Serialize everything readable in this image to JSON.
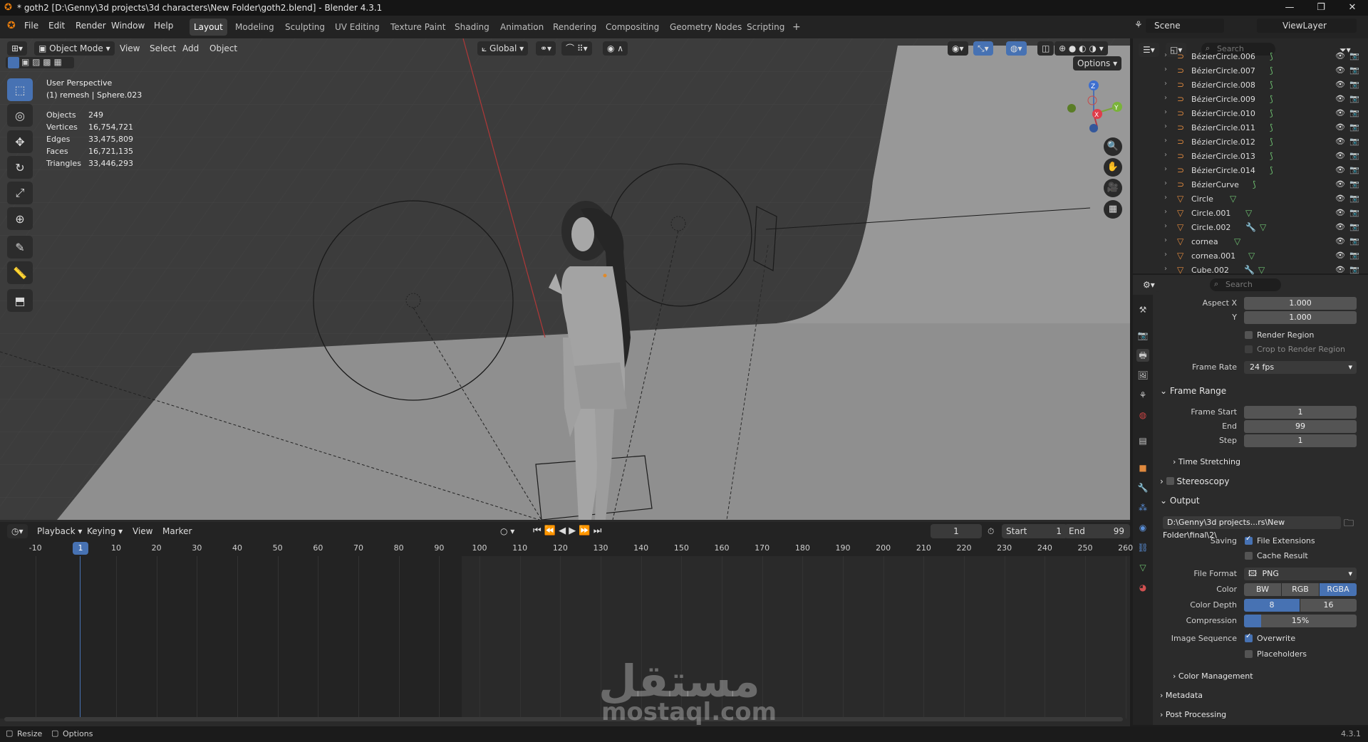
{
  "title_bar": {
    "title": "* goth2 [D:\\Genny\\3d projects\\3d characters\\New Folder\\goth2.blend] - Blender 4.3.1",
    "minimize": "—",
    "maximize": "❐",
    "close": "✕"
  },
  "menu": {
    "file": "File",
    "edit": "Edit",
    "render": "Render",
    "window": "Window",
    "help": "Help"
  },
  "workspaces": [
    "Layout",
    "Modeling",
    "Sculpting",
    "UV Editing",
    "Texture Paint",
    "Shading",
    "Animation",
    "Rendering",
    "Compositing",
    "Geometry Nodes",
    "Scripting"
  ],
  "workspace_add": "+",
  "scene_selector": {
    "label": "Scene",
    "view_layer": "ViewLayer"
  },
  "viewport_header": {
    "mode": "Object Mode",
    "view": "View",
    "select": "Select",
    "add": "Add",
    "object": "Object",
    "orientation": "Global",
    "options": "Options"
  },
  "viewport_info": {
    "perspective": "User Perspective",
    "object": "(1) remesh | Sphere.023",
    "stats": [
      {
        "label": "Objects",
        "value": "249"
      },
      {
        "label": "Vertices",
        "value": "16,754,721"
      },
      {
        "label": "Edges",
        "value": "33,475,809"
      },
      {
        "label": "Faces",
        "value": "16,721,135"
      },
      {
        "label": "Triangles",
        "value": "33,446,293"
      }
    ]
  },
  "gizmo": {
    "z": "Z",
    "y": "Y",
    "x": "X"
  },
  "timeline_header": {
    "playback": "Playback",
    "keying": "Keying",
    "view": "View",
    "marker": "Marker",
    "current_frame": "1",
    "start_label": "Start",
    "start_value": "1",
    "end_label": "End",
    "end_value": "99"
  },
  "timeline_ticks": [
    "-10",
    "1",
    "10",
    "20",
    "30",
    "40",
    "50",
    "60",
    "70",
    "80",
    "90",
    "100",
    "110",
    "120",
    "130",
    "140",
    "150",
    "160",
    "170",
    "180",
    "190",
    "200",
    "210",
    "220",
    "230",
    "240",
    "250",
    "260"
  ],
  "watermark": {
    "arabic": "مستقل",
    "latin": "mostaql.com"
  },
  "outliner": {
    "search_placeholder": "Search",
    "items": [
      {
        "name": "BézierCircle.006",
        "type": "curve"
      },
      {
        "name": "BézierCircle.007",
        "type": "curve"
      },
      {
        "name": "BézierCircle.008",
        "type": "curve"
      },
      {
        "name": "BézierCircle.009",
        "type": "curve"
      },
      {
        "name": "BézierCircle.010",
        "type": "curve"
      },
      {
        "name": "BézierCircle.011",
        "type": "curve"
      },
      {
        "name": "BézierCircle.012",
        "type": "curve"
      },
      {
        "name": "BézierCircle.013",
        "type": "curve"
      },
      {
        "name": "BézierCircle.014",
        "type": "curve"
      },
      {
        "name": "BézierCurve",
        "type": "curve"
      },
      {
        "name": "Circle",
        "type": "mesh"
      },
      {
        "name": "Circle.001",
        "type": "mesh"
      },
      {
        "name": "Circle.002",
        "type": "mesh"
      },
      {
        "name": "cornea",
        "type": "mesh"
      },
      {
        "name": "cornea.001",
        "type": "mesh"
      },
      {
        "name": "Cube.002",
        "type": "mesh"
      }
    ]
  },
  "properties": {
    "search_placeholder": "Search",
    "aspect_x_label": "Aspect X",
    "aspect_x": "1.000",
    "aspect_y_label": "Y",
    "aspect_y": "1.000",
    "render_region": "Render Region",
    "crop_region": "Crop to Render Region",
    "frame_rate_label": "Frame Rate",
    "frame_rate": "24 fps",
    "frame_range": "Frame Range",
    "frame_start_label": "Frame Start",
    "frame_start": "1",
    "end_label": "End",
    "end": "99",
    "step_label": "Step",
    "step": "1",
    "time_stretching": "Time Stretching",
    "stereoscopy": "Stereoscopy",
    "output": "Output",
    "output_path": "D:\\Genny\\3d projects...rs\\New Folder\\final\\2\\",
    "saving_label": "Saving",
    "file_extensions": "File Extensions",
    "cache_result": "Cache Result",
    "file_format_label": "File Format",
    "file_format": "PNG",
    "color_label": "Color",
    "color_bw": "BW",
    "color_rgb": "RGB",
    "color_rgba": "RGBA",
    "color_depth_label": "Color Depth",
    "depth_8": "8",
    "depth_16": "16",
    "compression_label": "Compression",
    "compression": "15%",
    "compression_value": 0.15,
    "image_sequence_label": "Image Sequence",
    "overwrite": "Overwrite",
    "placeholders": "Placeholders",
    "color_management": "Color Management",
    "metadata": "Metadata",
    "post_processing": "Post Processing"
  },
  "status_bar": {
    "resize": "Resize",
    "options": "Options",
    "version": "4.3.1"
  },
  "colors": {
    "accent": "#4772b3",
    "curve_icon": "#e0893e",
    "modifier": "#6ec071"
  }
}
